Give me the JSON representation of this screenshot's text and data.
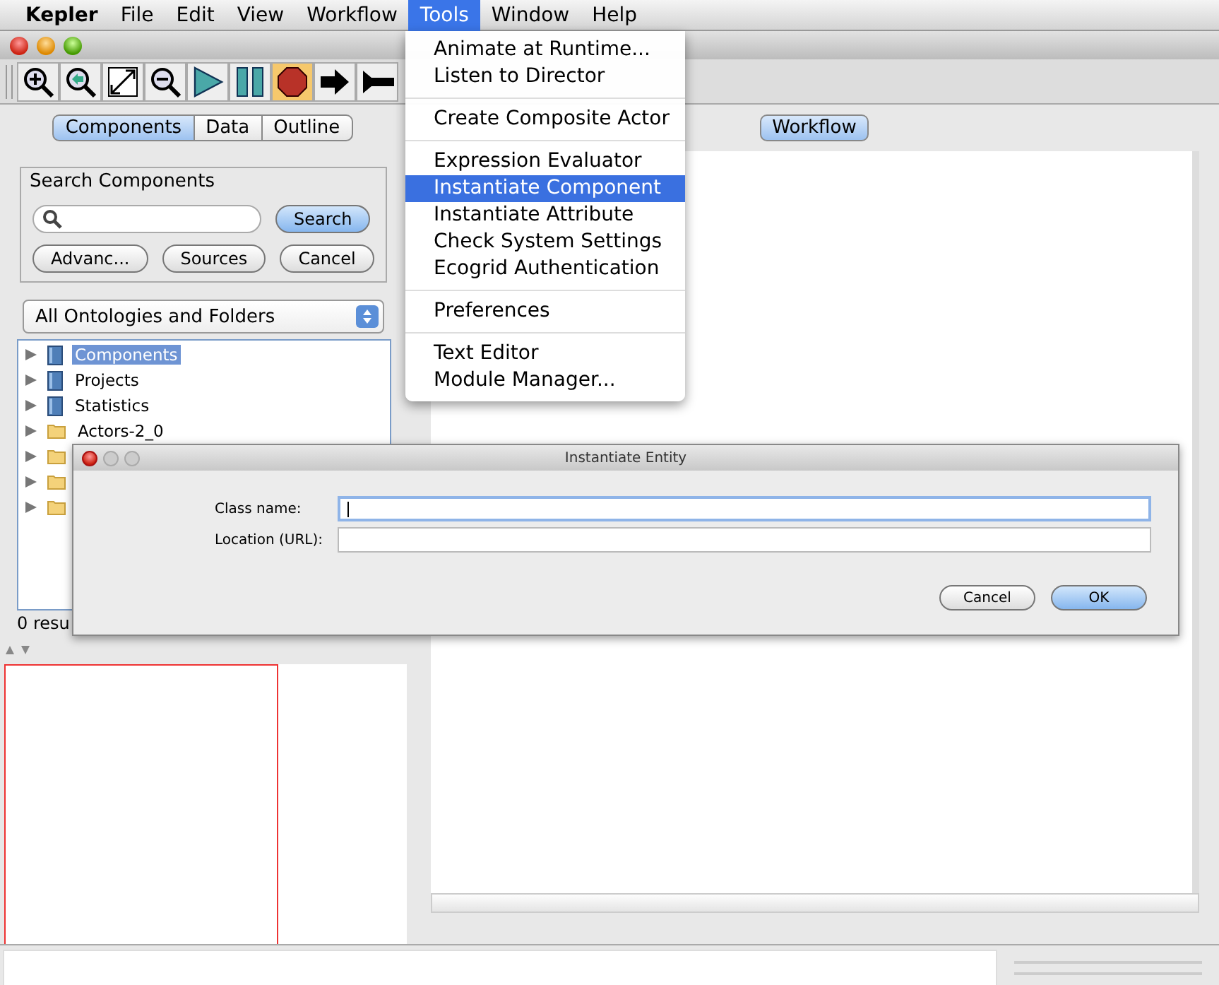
{
  "menubar": [
    {
      "label": "Kepler",
      "kind": "app",
      "selected": false
    },
    {
      "label": "File",
      "kind": "menu",
      "selected": false
    },
    {
      "label": "Edit",
      "kind": "menu",
      "selected": false
    },
    {
      "label": "View",
      "kind": "menu",
      "selected": false
    },
    {
      "label": "Workflow",
      "kind": "menu",
      "selected": false
    },
    {
      "label": "Tools",
      "kind": "menu",
      "selected": true
    },
    {
      "label": "Window",
      "kind": "menu",
      "selected": false
    },
    {
      "label": "Help",
      "kind": "menu",
      "selected": false
    }
  ],
  "toolbar": [
    {
      "kind": "zoom-in",
      "selected": false
    },
    {
      "kind": "zoom-reset",
      "selected": false
    },
    {
      "kind": "fit",
      "selected": false
    },
    {
      "kind": "zoom-out",
      "selected": false
    },
    {
      "kind": "run",
      "selected": false
    },
    {
      "kind": "pause",
      "selected": false
    },
    {
      "kind": "stop",
      "selected": true
    },
    {
      "kind": "arrow",
      "selected": false
    },
    {
      "kind": "arrow-tail",
      "selected": false
    }
  ],
  "left_tabs": [
    {
      "label": "Components",
      "selected": true
    },
    {
      "label": "Data",
      "selected": false
    },
    {
      "label": "Outline",
      "selected": false
    }
  ],
  "search": {
    "title": "Search Components",
    "button": "Search",
    "buttons": [
      "Advanc...",
      "Sources",
      "Cancel"
    ]
  },
  "dropdown": {
    "value": "All Ontologies and Folders"
  },
  "tree": [
    {
      "kind": "book",
      "label": "Components",
      "selected": true
    },
    {
      "kind": "book",
      "label": "Projects",
      "selected": false
    },
    {
      "kind": "book",
      "label": "Statistics",
      "selected": false
    },
    {
      "kind": "folder",
      "label": "Actors-2_0",
      "selected": false
    },
    {
      "kind": "folder"
    },
    {
      "kind": "folder"
    },
    {
      "kind": "folder"
    }
  ],
  "results": "0 resu",
  "workflow_tab": {
    "label": "Workflow",
    "selected": true
  },
  "tools_menu": {
    "groups": [
      [
        {
          "label": "Animate at Runtime...",
          "selected": false
        },
        {
          "label": "Listen to Director",
          "selected": false
        }
      ],
      [
        {
          "label": "Create Composite Actor",
          "selected": false
        }
      ],
      [
        {
          "label": "Expression Evaluator",
          "selected": false
        },
        {
          "label": "Instantiate Component",
          "selected": true
        },
        {
          "label": "Instantiate Attribute",
          "selected": false
        },
        {
          "label": "Check System Settings",
          "selected": false
        },
        {
          "label": "Ecogrid Authentication",
          "selected": false
        }
      ],
      [
        {
          "label": "Preferences",
          "selected": false
        }
      ],
      [
        {
          "label": "Text Editor",
          "selected": false
        },
        {
          "label": "Module Manager...",
          "selected": false
        }
      ]
    ]
  },
  "dialog": {
    "title": "Instantiate Entity",
    "fields": [
      {
        "label": "Class name:",
        "focused": true
      },
      {
        "label": "Location (URL):",
        "focused": false
      }
    ],
    "buttons": [
      {
        "label": "Cancel",
        "kind": "normal"
      },
      {
        "label": "OK",
        "kind": "default"
      }
    ]
  }
}
